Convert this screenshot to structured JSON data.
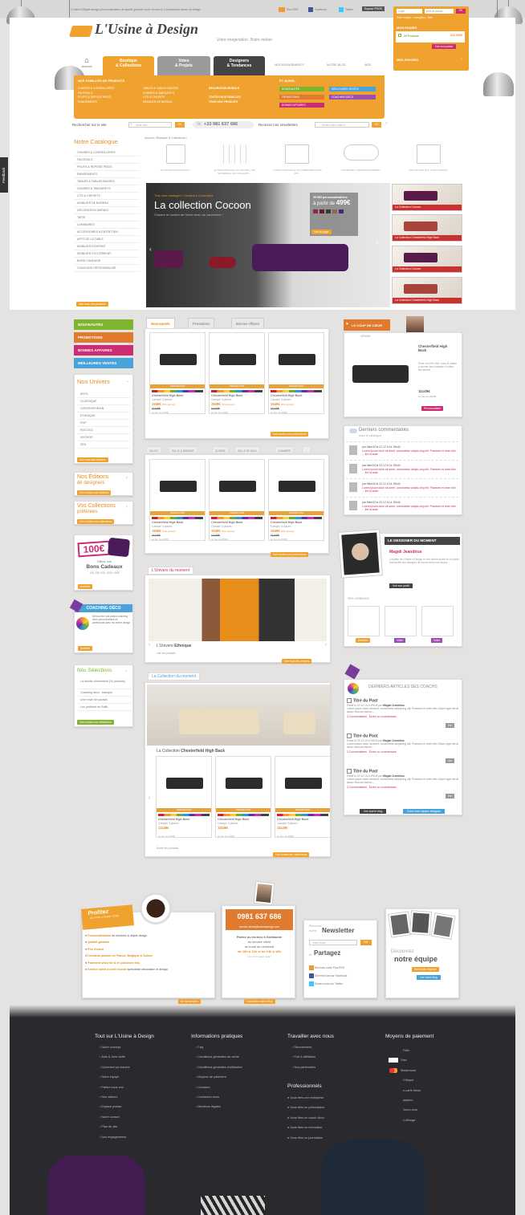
{
  "topbar": {
    "tagline": "L'Usine d'Objets design personnalisables de qualité garantie à prix d'usine & Communauté autour du design",
    "flux": "Flux RSS",
    "facebook": "Facebook",
    "twitter": "Twitter",
    "espace": "Espace PROS"
  },
  "login": {
    "login_ph": "Login",
    "password_ph": "Mot de passe",
    "ok": "OK",
    "votre_espace": "Votre espace : Inscription - Aide",
    "panier_title": "MON PANIER",
    "panier_count": "25 Produits",
    "panier_total": "213 000€",
    "panier_btn": "Voir mon panier",
    "favoris": "MES FAVORIS"
  },
  "logo": {
    "name": "L'Usine à Design",
    "slogan": "Votre imagination. Notre métier."
  },
  "nav": {
    "accueil": "Accueil",
    "tabs": [
      {
        "l1": "Boutique",
        "l2": "& Collections"
      },
      {
        "l1": "Votes",
        "l2": "& Projets"
      },
      {
        "l1": "Designers",
        "l2": "& Tendances"
      }
    ],
    "links": [
      "NOS ENGAGEMENTS",
      "NOTRE BLOG",
      "AIDE"
    ]
  },
  "families": {
    "title": "NOS FAMILLES DE PRODUITS",
    "col1": [
      "CHAISES & CONSEILLERES",
      "FAUTEUILS",
      "POUFS & REPOSE PIEDS",
      "RANGEMENTS"
    ],
    "col2": [
      "TABLES & TABLES BASSES",
      "CHAISES & TABOURETS",
      "LITS & CHEVETS",
      "MOBILIER DE BUREAU"
    ],
    "col3": [
      "DÉCORATION MURALE",
      "",
      "TOUTES NOS FAMILLES",
      "TOUS NOS PRODUITS"
    ],
    "aussi_title": "ET AUSSI...",
    "aussi": [
      "NOUVEAUTÉS",
      "MEILLEURES VENTES",
      "PROMOTIONS",
      "COACHING DÉCO",
      "BONNES AFFAIRES"
    ]
  },
  "searchbar": {
    "label": "Rechercher sur le site",
    "placeholder": "Mots clés",
    "ok": "OK",
    "phone": "+33 981 637 686",
    "newsletter_label": "Recevez nos newsletters",
    "email_ph": "Entrez votre email ici"
  },
  "catalogue": {
    "title": "Notre Catalogue",
    "items": [
      "CHAISES & CONSEILLERES",
      "FAUTEUILS",
      "POUFS & REPOSE PIEDS",
      "RANGEMENTS",
      "TABLES & TABLES BASSES",
      "CHAISES & TABOURETS",
      "LITS & CHEVETS",
      "MOBILIER DE BUREAU",
      "DÉCORATION MURALE",
      "TAPIS",
      "LUMINAIRES",
      "ACCESSOIRES & ENTRETIEN",
      "ARTS DE LA TABLE",
      "MOBILIER D'ENFANT",
      "MOBILIER D'EXTÉRIEUR",
      "BORD CANDAGE",
      "COACHING PERSONNALISÉ"
    ],
    "all_btn": "Voir tous nos produits"
  },
  "breadcrumb": "Accueil  /  Boutique & Collections  /",
  "steps": [
    "JE CHOISIS MON PRODUIT...",
    "JE PERSONNALISE LES OPTIONS, LES MATIÈRES & LES COULEURS...",
    "L'USINE A DESIGN LE FAIT FABRIQUER POUR MOI...",
    "J'ACHEMINE À TRAVERS LE MONDE...",
    "DÉCOR CHEZ MOI, À PRIX D'USINE !"
  ],
  "hero": {
    "crumb": "Tous notre catalogue / Canapes & Conviviales",
    "title": "La collection Cocoon",
    "subtitle": "Chaleur et confort de l'hiver avec du cachemire !",
    "count": "39 953 personnalisations",
    "price_label": "à partir de",
    "price": "499€",
    "btn": "Voir la page",
    "thumbs": [
      "La Collection Cocoon",
      "La Collection Chesterfield High Back",
      "La Collection Cocoon",
      "La Collection Chesterfield High Back"
    ]
  },
  "left": {
    "buttons": [
      "NOUVEAUTÉS",
      "PROMOTIONS",
      "BONNES AFFAIRES",
      "MEILLEURES VENTES"
    ],
    "univers_title": "Nos Univers",
    "univers": [
      "ARTS",
      "CLASSIQUE",
      "CONTEMPORAIN",
      "ETHNIQUE",
      "POP",
      "ROCOCO",
      "VINTAGE",
      "ZEN"
    ],
    "univers_btn": "Voir tous nos univers",
    "editions_title": "Nos Éditions",
    "editions_sub": "de designers",
    "editions_btn": "Voir toutes nos éditions",
    "collections_title": "Vos Collections",
    "collections_sub": "préférées",
    "collections_btn": "Voir toutes nos collections",
    "bon_amount": "100€",
    "bon_offer": "Offrez nos",
    "bon_title": "Bons Cadeaux",
    "bon_values": "10€, 25€, 50€, 100€, 150€",
    "bon_btn": "Acheter",
    "coaching_title": "COACHING DÉCO",
    "coaching_text": "Découvrez nos packs coaching déco personnalisés en partenariat avec my home design",
    "coaching_btn": "Acheter",
    "selections_title": "Nos Sélections",
    "selections": [
      "La famille chesterfield (10 produits)",
      "Coaching déco : baroque",
      "Une envie de paradis",
      "Les préférés de Rafik"
    ],
    "selections_btn": "Voir toutes nos sélections"
  },
  "center": {
    "tabs": [
      "Nouveautés",
      "Promotions",
      "Bonnes Affaires"
    ],
    "product": {
      "promo": "PROMOTION",
      "name": "Chesterfield High Back",
      "sub": "Canapé 3 places",
      "price": "1549€",
      "price_note": "(Prix promo)",
      "old": "11149€",
      "note": "au lieu de 2000€"
    },
    "promos_btn": "Voir toutes nos promotions",
    "room_tabs": [
      "SALON",
      "SALLE À MANGER",
      "CUISINE",
      "SALLE DE BAIN",
      "CHAMBRE",
      "..."
    ],
    "promos_btn2": "Voir toutes nos promotions",
    "univers_title": "L'Univers du moment",
    "univers_name": "L'Univers",
    "univers_name_b": "Ethnique",
    "univers_link": "voir les produits",
    "univers_btn": "Voir tous les univers",
    "coll_title": "La Collection du moment",
    "coll_name": "La Collection",
    "coll_name_b": "Chesterfield High Back",
    "coll_price": "11149€",
    "coll_link": "Aimer les produits",
    "coll_btn": "Voir toutes les collections"
  },
  "right": {
    "coeur_title": "LE COUP DE CŒUR",
    "coeur_by": "d'Emilie",
    "coeur_name": "Chesterfield High Back",
    "coeur_text": "Rose von Kirk Irde, nous la charte à donner faut s'adapte à toutes les favoris!",
    "coeur_price": "11149€",
    "coeur_note": "au lieu de 2000€",
    "coeur_btn": "Personnaliser",
    "comments_title": "Derniers commentaires",
    "comments_sub": "dans le catalogue",
    "comments": [
      {
        "by": "par Mimi33 le 22.12.10 à 19h40",
        "text": "Lorem ipsum dolor sit amet, consectetur adipis-cing elit. Praesent et ante nibh ... lire la suite"
      },
      {
        "by": "par Mimi33 le 22.12.10 à 19h40",
        "text": "Lorem ipsum dolor sit amet, consectetur adipis-cing elit. Praesent et ante nibh ... lire la suite"
      },
      {
        "by": "par Mimi33 le 22.12.10 à 19h40",
        "text": "Lorem ipsum dolor sit amet, consectetur adipis-cing elit. Praesent et ante nibh ... lire la suite"
      },
      {
        "by": "par Mimi33 le 22.12.10 à 19h40",
        "text": "Lorem ipsum dolor sit amet, consectetur adipis-cing elit. Praesent et ante nibh ... lire la suite"
      }
    ],
    "designer_title": "LE DESIGNER DU MOMENT",
    "designer_name": "Magali Jeandirus",
    "designer_text": "L'équipe de L'Usine à Design et moi même avons eu le plaisir d'accueillir une designer de renom dans nos locaux...",
    "designer_btn": "Voir son profil",
    "creations": "Ses créations",
    "creation_btns": [
      "Acheter",
      "Voter",
      "Voter"
    ],
    "articles_title": "DERNIERS ARTICLES DES COACHS",
    "posts": [
      {
        "title": "Titre du Post",
        "date": "Posté le 22.12.10 à 19h43 par",
        "author": "Magali Jeandirus",
        "text": "Lorem ipsum dolor sit amet, consectetur adipiscing elit. Praesent et ante nibh. Etiam eget est at lacus rhoncus viverra ...",
        "comments": "3 Commentaires",
        "write": "Écrire un commentaire",
        "lire": "lire"
      },
      {
        "title": "Titre du Post",
        "date": "Posté le 22.12.10 à 19h43 par",
        "author": "Magali Jeandirus",
        "text": "Lorem ipsum dolor sit amet, consectetur adipiscing elit. Praesent et ante nibh. Etiam eget est at lacus rhoncus viverra ...",
        "comments": "3 Commentaires",
        "write": "Écrire un commentaire",
        "lire": "lire"
      },
      {
        "title": "Titre du Post",
        "date": "Posté le 22.12.10 à 19h43 par",
        "author": "Magali Jeandirus",
        "text": "Lorem ipsum dolor sit amet, consectetur adipiscing elit. Praesent et ante nibh. Etiam eget est at lacus rhoncus viverra ...",
        "comments": "3 Commentaires",
        "write": "Écrire un commentaire",
        "lire": "lire"
      }
    ],
    "blog_btn": "Voir tout le blog",
    "coach_btn": "Créer mon espace designer"
  },
  "profitez": {
    "title": "Profitez",
    "sub": "...de l'Usine à Design ! bingo",
    "items": [
      {
        "b": "Personnalisation",
        "t": "de meubles & objets design"
      },
      {
        "b": "Qualité garantie",
        "t": ""
      },
      {
        "b": "Prix d'usine",
        "t": ""
      },
      {
        "b": "Livraison partout en France, Belgique & Suisse",
        "t": ""
      },
      {
        "b": "Paiement sécurisé & en plusieurs fois",
        "t": ""
      },
      {
        "b": "Service client à votre écoute",
        "t": "spécialiste décoration et design"
      }
    ],
    "btn": "En savoir plus"
  },
  "contact": {
    "email": "service-clients@lusineadesign.com",
    "phone": "0981 637 686",
    "t1": "Parlez ou écrivez à Guillaume",
    "t2": "au service client",
    "t3": "du lundi au vendredi",
    "t4": "de 10h à 12h et de 14h à 18h",
    "t5": "( prix d'un appel local )",
    "btn": "Consultez notre FAQ"
  },
  "newsletter": {
    "recevez": "Recevez",
    "notre": "notre",
    "title": "Newsletter",
    "email_ph": "Votre Email",
    "ok": "OK",
    "partagez": "Partagez",
    "et": "et",
    "rss": "Recevez notre Flux RSS",
    "fb": "Devenez fan sur Facebook",
    "tw": "Suivez-nous sur Twitter"
  },
  "equipe": {
    "t1": "Découvrez",
    "t2": "notre équipe",
    "btn1": "Voir toute l'équipe",
    "btn2": "Lire notre blog"
  },
  "footer": {
    "col1_title": "Tout sur L'Usine à Design",
    "col1": [
      "Notre concept",
      "Aide & 1ère visite",
      "Comment ça marche",
      "Notre équipe",
      "Parlez nous vrai",
      "Nos valeurs",
      "Espace presse",
      "Notre conseil",
      "Plan du site",
      "Nos engagements"
    ],
    "col2_title": "Informations pratiques",
    "col2": [
      "Faq",
      "Conditions générales de vente",
      "Conditions générales d'utilisation",
      "Moyens de paiement",
      "Livraison",
      "Contactez-nous",
      "Mentions légales"
    ],
    "col3_title": "Travailler avec nous",
    "col3": [
      "Recrutement",
      "Pub & Affiliation",
      "Nos partenaires"
    ],
    "pro_title": "Professionnels",
    "pro": [
      "Vous êtes une entreprise",
      "Vous êtes un prescripteur",
      "Vous êtes un coach déco",
      "Vous êtes un revendeur",
      "Vous êtes un journaliste"
    ],
    "col4_title": "Moyens de paiement",
    "col4": [
      "Fidlo",
      "Visa",
      "Mastercard",
      "Chèque",
      "e-carte bleue",
      "paybox",
      "1euro.com",
      "Cofinoga"
    ]
  },
  "feedback": "Feedback",
  "colors": {
    "orange": "#f0a22e",
    "pink": "#cc2c74",
    "green": "#7fb52e",
    "blue": "#4aa3d8",
    "dark": "#2a2a2e"
  }
}
